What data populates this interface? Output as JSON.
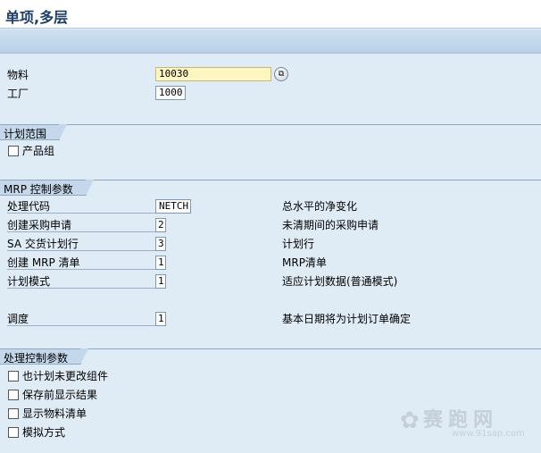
{
  "window": {
    "title": "单项,多层"
  },
  "header_fields": {
    "material": {
      "label": "物料",
      "value": "10030"
    },
    "plant": {
      "label": "工厂",
      "value": "1000"
    }
  },
  "scope": {
    "title": "计划范围",
    "product_group": {
      "label": "产品组",
      "checked": false
    }
  },
  "mrp": {
    "title": "MRP 控制参数",
    "rows": [
      {
        "label": "处理代码",
        "value": "NETCH",
        "desc": "总水平的净变化"
      },
      {
        "label": "创建采购申请",
        "value": "2",
        "desc": "未清期间的采购申请"
      },
      {
        "label": "SA 交货计划行",
        "value": "3",
        "desc": "计划行"
      },
      {
        "label": "创建 MRP 清单",
        "value": "1",
        "desc": "MRP清单"
      },
      {
        "label": "计划模式",
        "value": "1",
        "desc": "适应计划数据(普通模式)"
      },
      {
        "label": "调度",
        "value": "1",
        "desc": "基本日期将为计划订单确定"
      }
    ]
  },
  "processing": {
    "title": "处理控制参数",
    "options": [
      {
        "label": "也计划未更改组件",
        "checked": false
      },
      {
        "label": "保存前显示结果",
        "checked": false
      },
      {
        "label": "显示物料清单",
        "checked": false
      },
      {
        "label": "模拟方式",
        "checked": false
      }
    ]
  },
  "watermark": {
    "text": "赛跑网",
    "url": "www.91sap.com"
  },
  "colors": {
    "background": "#dfebf5",
    "title": "#1f3f66",
    "required_field": "#fdf6c0"
  },
  "icons": {
    "match_button": "matchcode-icon",
    "watermark": "runner-icon"
  }
}
